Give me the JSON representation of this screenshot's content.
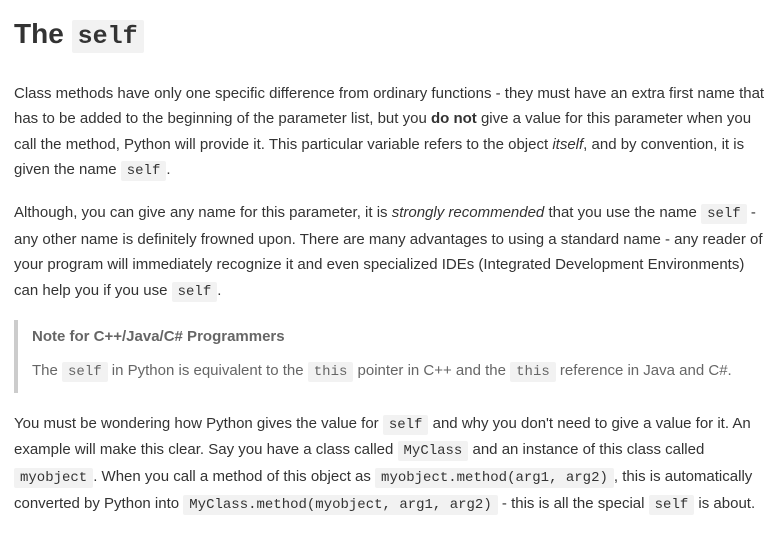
{
  "heading": {
    "prefix": "The ",
    "code": "self"
  },
  "para1": {
    "t1": "Class methods have only one specific difference from ordinary functions - they must have an extra first name that has to be added to the beginning of the parameter list, but you ",
    "bold": "do not",
    "t2": " give a value for this parameter when you call the method, Python will provide it. This particular variable refers to the object ",
    "em": "itself",
    "t3": ", and by convention, it is given the name ",
    "code": "self",
    "t4": "."
  },
  "para2": {
    "t1": "Although, you can give any name for this parameter, it is ",
    "em": "strongly recommended",
    "t2": " that you use the name ",
    "code": "self",
    "t3": " - any other name is definitely frowned upon. There are many advantages to using a standard name - any reader of your program will immediately recognize it and even specialized IDEs (Integrated Development Environments) can help you if you use ",
    "code2": "self",
    "t4": "."
  },
  "note": {
    "title": "Note for C++/Java/C# Programmers",
    "t1": "The ",
    "code1": "self",
    "t2": " in Python is equivalent to the ",
    "code2": "this",
    "t3": " pointer in C++ and the ",
    "code3": "this",
    "t4": " reference in Java and C#."
  },
  "para3": {
    "t1": "You must be wondering how Python gives the value for ",
    "c1": "self",
    "t2": " and why you don't need to give a value for it. An example will make this clear. Say you have a class called ",
    "c2": "MyClass",
    "t3": " and an instance of this class called ",
    "c3": "myobject",
    "t4": ". When you call a method of this object as ",
    "c4": "myobject.method(arg1, arg2)",
    "t5": ", this is automatically converted by Python into ",
    "c5": "MyClass.method(myobject, arg1, arg2)",
    "t6": " - this is all the special ",
    "c6": "self",
    "t7": " is about."
  }
}
